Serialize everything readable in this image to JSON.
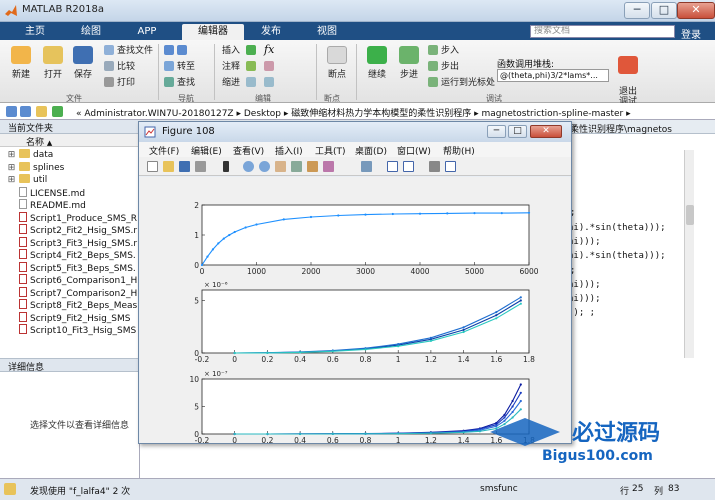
{
  "window": {
    "title": "MATLAB R2018a",
    "min": "─",
    "max": "□",
    "close": "✕"
  },
  "ribbon": {
    "tabs": [
      "主页",
      "绘图",
      "APP",
      "编辑器",
      "发布",
      "视图"
    ],
    "active_tab": "编辑器",
    "search_placeholder": "搜索文档",
    "login": "登录"
  },
  "toolstrip": {
    "file": {
      "new": "新建",
      "open": "打开",
      "save": "保存",
      "find_files": "查找文件",
      "compare": "比较",
      "print": "打印",
      "group": "文件"
    },
    "navigate": {
      "goto": "转至",
      "find": "查找",
      "group": "导航"
    },
    "edit": {
      "insert": "插入",
      "comment": "注释",
      "indent": "缩进",
      "group": "编辑"
    },
    "breakpoints": {
      "label": "断点",
      "group": "断点"
    },
    "debug": {
      "continue": "继续",
      "step": "步进",
      "step_in": "步入",
      "step_out": "步出",
      "run_to_cursor": "运行到光标处",
      "group": "调试"
    },
    "function_call_stack": {
      "label": "函数调用堆栈:",
      "value": "@(theta,phi)3/2*lams*..."
    },
    "exit_debug": "退出\n调试"
  },
  "address": {
    "prefix": "«",
    "segments": [
      "Administrator.WIN7U-20180127Z",
      "Desktop",
      "磁致伸缩材料热力学本构模型的柔性识别程序",
      "magnetostriction-spline-master"
    ]
  },
  "current_folder": {
    "title": "当前文件夹",
    "column": "名称",
    "sort_arrow": "▲",
    "items": [
      {
        "name": "data",
        "type": "folder"
      },
      {
        "name": "splines",
        "type": "folder"
      },
      {
        "name": "util",
        "type": "folder"
      },
      {
        "name": "LICENSE.md",
        "type": "md"
      },
      {
        "name": "README.md",
        "type": "md"
      },
      {
        "name": "Script1_Produce_SMS_R",
        "type": "m"
      },
      {
        "name": "Script2_Fit2_Hsig_SMS.r",
        "type": "m"
      },
      {
        "name": "Script3_Fit3_Hsig_SMS.r",
        "type": "m"
      },
      {
        "name": "Script4_Fit2_Beps_SMS.",
        "type": "m"
      },
      {
        "name": "Script5_Fit3_Beps_SMS.",
        "type": "m"
      },
      {
        "name": "Script6_Comparison1_H",
        "type": "m"
      },
      {
        "name": "Script7_Comparison2_H",
        "type": "m"
      },
      {
        "name": "Script8_Fit2_Beps_Meas",
        "type": "m"
      },
      {
        "name": "Script9_Fit2_Hsig_SMS",
        "type": "m"
      },
      {
        "name": "Script10_Fit3_Hsig_SMS",
        "type": "m"
      }
    ]
  },
  "details": {
    "title": "详细信息",
    "hint": "选择文件以查看详细信息"
  },
  "editor": {
    "tab_text": "柔性识别程序\\magnetos",
    "code_lines": [
      ";",
      "hi).*sin(theta)));",
      "hi)));",
      "hi).*sin(theta)));",
      ";",
      "hi)));",
      "hi)));",
      "));    ;"
    ]
  },
  "figure": {
    "title": "Figure 108",
    "menus": [
      "文件(F)",
      "编辑(E)",
      "查看(V)",
      "插入(I)",
      "工具(T)",
      "桌面(D)",
      "窗口(W)",
      "帮助(H)"
    ],
    "win_min": "─",
    "win_max": "□",
    "win_close": "✕"
  },
  "chart_data": [
    {
      "type": "line",
      "x": [
        0,
        100,
        200,
        300,
        400,
        500,
        600,
        800,
        1000,
        1500,
        2000,
        2500,
        3000,
        3500,
        4000,
        4500,
        5000,
        5500,
        6000
      ],
      "series": [
        {
          "values": [
            0,
            0.28,
            0.52,
            0.72,
            0.88,
            1.0,
            1.1,
            1.25,
            1.35,
            1.52,
            1.6,
            1.65,
            1.68,
            1.7,
            1.71,
            1.72,
            1.73,
            1.73,
            1.74
          ]
        }
      ],
      "xlim": [
        0,
        6000
      ],
      "ylim": [
        0,
        2
      ],
      "xticks": [
        "0",
        "1000",
        "2000",
        "3000",
        "4000",
        "5000",
        "6000"
      ],
      "yticks": [
        "0",
        "1",
        "2"
      ],
      "grid": false
    },
    {
      "type": "line",
      "x": [
        0,
        0.2,
        0.4,
        0.6,
        0.8,
        1.0,
        1.2,
        1.4,
        1.6,
        1.75
      ],
      "series": [
        {
          "values": [
            0,
            0.02,
            0.08,
            0.2,
            0.4,
            0.75,
            1.3,
            2.2,
            3.6,
            5.0
          ]
        },
        {
          "values": [
            0,
            0.03,
            0.1,
            0.24,
            0.46,
            0.85,
            1.45,
            2.45,
            3.9,
            5.3
          ]
        },
        {
          "values": [
            0,
            0.01,
            0.06,
            0.16,
            0.34,
            0.65,
            1.15,
            2.0,
            3.3,
            4.7
          ]
        }
      ],
      "xlim": [
        -0.2,
        1.8
      ],
      "ylim": [
        0,
        6
      ],
      "exponent": "× 10⁻⁶",
      "xticks": [
        "-0.2",
        "0",
        "0.2",
        "0.4",
        "0.6",
        "0.8",
        "1",
        "1.2",
        "1.4",
        "1.6",
        "1.8"
      ],
      "yticks": [
        "0",
        "5"
      ],
      "grid": false
    },
    {
      "type": "line",
      "x": [
        0,
        0.2,
        0.4,
        0.6,
        0.8,
        1.0,
        1.2,
        1.4,
        1.5,
        1.6,
        1.65,
        1.7,
        1.75
      ],
      "series": [
        {
          "values": [
            0,
            0,
            0.02,
            0.04,
            0.08,
            0.15,
            0.3,
            0.6,
            1.0,
            2.0,
            3.5,
            6.0,
            9.0
          ]
        },
        {
          "values": [
            0,
            0,
            0.01,
            0.03,
            0.06,
            0.12,
            0.25,
            0.5,
            0.9,
            1.7,
            3.0,
            5.0,
            7.5
          ]
        },
        {
          "values": [
            0,
            0,
            0.01,
            0.02,
            0.05,
            0.1,
            0.2,
            0.4,
            0.7,
            1.4,
            2.4,
            4.0,
            6.0
          ]
        },
        {
          "values": [
            0,
            0,
            0,
            0.01,
            0.03,
            0.06,
            0.14,
            0.3,
            0.5,
            1.0,
            1.8,
            3.0,
            4.5
          ]
        }
      ],
      "xlim": [
        -0.2,
        1.8
      ],
      "ylim": [
        0,
        10
      ],
      "exponent": "× 10⁻⁷",
      "xticks": [
        "-0.2",
        "0",
        "0.2",
        "0.4",
        "0.6",
        "0.8",
        "1",
        "1.2",
        "1.4",
        "1.6",
        "1.8"
      ],
      "yticks": [
        "0",
        "5",
        "10"
      ],
      "grid": false
    }
  ],
  "status": {
    "text": "发现使用 \"f_lalfa4\" 2 次",
    "func": "smsfunc",
    "row_label": "行",
    "row": "25",
    "col_label": "列",
    "col": "83"
  },
  "watermark": {
    "text": "必过源码",
    "url": "Bigus100.com"
  }
}
